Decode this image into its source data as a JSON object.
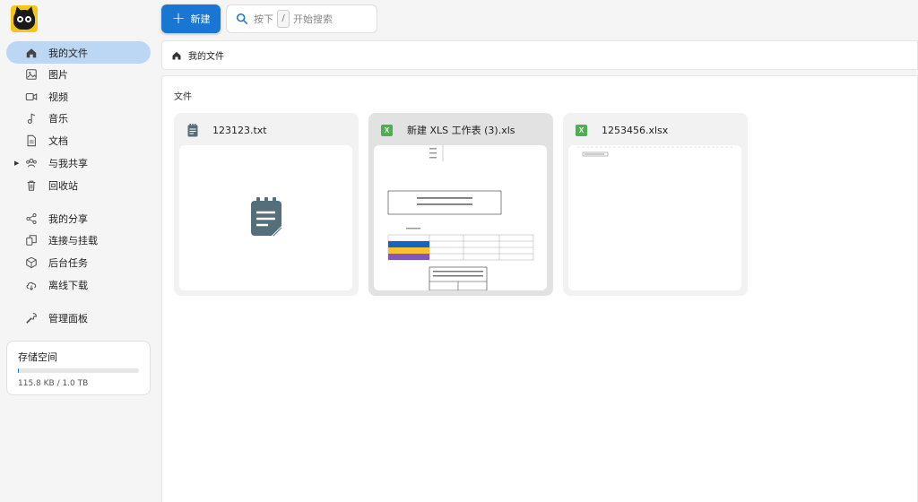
{
  "toolbar": {
    "new_label": "新建"
  },
  "search": {
    "prefix": "按下",
    "key": "/",
    "suffix": "开始搜索"
  },
  "sidebar": {
    "items": [
      {
        "label": "我的文件",
        "icon": "home-icon",
        "active": true
      },
      {
        "label": "图片",
        "icon": "image-icon"
      },
      {
        "label": "视频",
        "icon": "video-icon"
      },
      {
        "label": "音乐",
        "icon": "music-icon"
      },
      {
        "label": "文档",
        "icon": "document-icon"
      },
      {
        "label": "与我共享",
        "icon": "people-icon",
        "expandable": true
      },
      {
        "label": "回收站",
        "icon": "trash-icon"
      },
      {
        "label": "我的分享",
        "icon": "share-icon"
      },
      {
        "label": "连接与挂载",
        "icon": "mount-icon"
      },
      {
        "label": "后台任务",
        "icon": "task-icon"
      },
      {
        "label": "离线下载",
        "icon": "cloud-download-icon"
      },
      {
        "label": "管理面板",
        "icon": "wrench-icon"
      }
    ]
  },
  "storage": {
    "title": "存储空间",
    "usage": "115.8 KB / 1.0 TB",
    "used_fraction": 0.0001
  },
  "breadcrumb": {
    "root": "我的文件"
  },
  "main": {
    "section_title": "文件",
    "files": [
      {
        "name": "123123.txt",
        "type": "txt",
        "icon": "notepad-icon"
      },
      {
        "name": "新建 XLS 工作表 (3).xls",
        "type": "xls",
        "icon": "excel-icon",
        "badge": "X"
      },
      {
        "name": "1253456.xlsx",
        "type": "xlsx",
        "icon": "excel-icon",
        "badge": "X"
      }
    ]
  },
  "colors": {
    "accent": "#1976d2",
    "active_nav": "#bbd7f3",
    "excel": "#4caf50",
    "txt_icon": "#546e7a"
  }
}
